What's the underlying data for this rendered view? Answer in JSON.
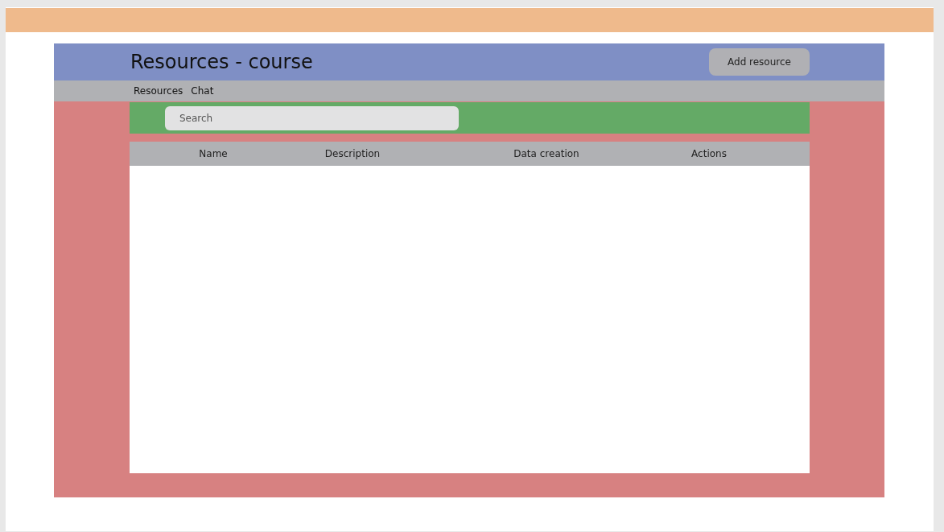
{
  "header": {
    "title": "Resources - course",
    "button": "Add resource"
  },
  "nav": {
    "items": [
      {
        "label": "Resources"
      },
      {
        "label": "Chat"
      }
    ]
  },
  "search": {
    "placeholder": "Search"
  },
  "table": {
    "columns": [
      "Name",
      "Description",
      "Data creation",
      "Actions"
    ]
  }
}
